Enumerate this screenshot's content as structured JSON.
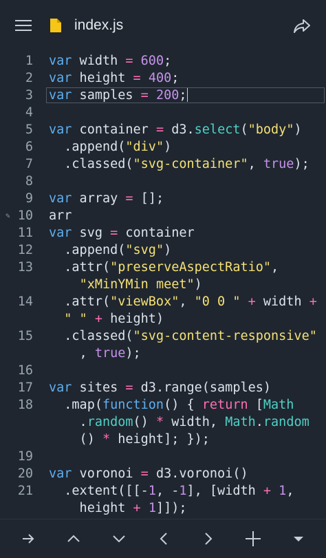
{
  "header": {
    "file_name": "index.js",
    "menu_icon": "hamburger-icon",
    "file_icon": "js-file-icon",
    "share_icon": "share-icon"
  },
  "colors": {
    "background": "#1f2630",
    "keyword": "#5fb0f0",
    "operator": "#ff6fb5",
    "number": "#c792ea",
    "string": "#f5e173",
    "function": "#4fd1c5",
    "text": "#dde3ea",
    "line_number": "#9aa4af"
  },
  "editor": {
    "current_line": 3,
    "lines": [
      {
        "num": "1",
        "tokens": [
          [
            "k",
            "var"
          ],
          [
            "p",
            " width "
          ],
          [
            "o",
            "="
          ],
          [
            "p",
            " "
          ],
          [
            "n",
            "600"
          ],
          [
            "p",
            ";"
          ]
        ]
      },
      {
        "num": "2",
        "tokens": [
          [
            "k",
            "var"
          ],
          [
            "p",
            " height "
          ],
          [
            "o",
            "="
          ],
          [
            "p",
            " "
          ],
          [
            "n",
            "400"
          ],
          [
            "p",
            ";"
          ]
        ]
      },
      {
        "num": "3",
        "tokens": [
          [
            "k",
            "var"
          ],
          [
            "p",
            " samples "
          ],
          [
            "o",
            "="
          ],
          [
            "p",
            " "
          ],
          [
            "n",
            "200"
          ],
          [
            "p",
            ";"
          ]
        ]
      },
      {
        "num": "4",
        "tokens": []
      },
      {
        "num": "5",
        "tokens": [
          [
            "k",
            "var"
          ],
          [
            "p",
            " container "
          ],
          [
            "o",
            "="
          ],
          [
            "p",
            " d3."
          ],
          [
            "f",
            "select"
          ],
          [
            "p",
            "("
          ],
          [
            "s",
            "\"body\""
          ],
          [
            "p",
            ")"
          ]
        ]
      },
      {
        "num": "6",
        "tokens": [
          [
            "p",
            "  ."
          ],
          [
            "p",
            "append("
          ],
          [
            "s",
            "\"div\""
          ],
          [
            "p",
            ")"
          ]
        ]
      },
      {
        "num": "7",
        "tokens": [
          [
            "p",
            "  .classed("
          ],
          [
            "s",
            "\"svg-container\""
          ],
          [
            "p",
            ", "
          ],
          [
            "n",
            "true"
          ],
          [
            "p",
            ");"
          ]
        ]
      },
      {
        "num": "8",
        "tokens": []
      },
      {
        "num": "9",
        "tokens": [
          [
            "k",
            "var"
          ],
          [
            "p",
            " array "
          ],
          [
            "o",
            "="
          ],
          [
            "p",
            " [];"
          ]
        ]
      },
      {
        "num": "10",
        "tokens": [
          [
            "p",
            "arr"
          ]
        ]
      },
      {
        "num": "11",
        "tokens": [
          [
            "k",
            "var"
          ],
          [
            "p",
            " svg "
          ],
          [
            "o",
            "="
          ],
          [
            "p",
            " container"
          ]
        ]
      },
      {
        "num": "12",
        "tokens": [
          [
            "p",
            "  .append("
          ],
          [
            "s",
            "\"svg\""
          ],
          [
            "p",
            ")"
          ]
        ]
      },
      {
        "num": "13",
        "tokens": [
          [
            "p",
            "  .attr("
          ],
          [
            "s",
            "\"preserveAspectRatio\""
          ],
          [
            "p",
            ","
          ]
        ]
      },
      {
        "num": "",
        "tokens": [
          [
            "p",
            "    "
          ],
          [
            "s",
            "\"xMinYMin meet\""
          ],
          [
            "p",
            ")"
          ]
        ]
      },
      {
        "num": "14",
        "tokens": [
          [
            "p",
            "  .attr("
          ],
          [
            "s",
            "\"viewBox\""
          ],
          [
            "p",
            ", "
          ],
          [
            "s",
            "\"0 0 \""
          ],
          [
            "p",
            " "
          ],
          [
            "o",
            "+"
          ],
          [
            "p",
            " width "
          ],
          [
            "o",
            "+"
          ]
        ]
      },
      {
        "num": "",
        "tokens": [
          [
            "p",
            "  "
          ],
          [
            "s",
            "\" \""
          ],
          [
            "p",
            " "
          ],
          [
            "o",
            "+"
          ],
          [
            "p",
            " height)"
          ]
        ]
      },
      {
        "num": "15",
        "tokens": [
          [
            "p",
            "  .classed("
          ],
          [
            "s",
            "\"svg-content-responsive\""
          ]
        ]
      },
      {
        "num": "",
        "tokens": [
          [
            "p",
            "    , "
          ],
          [
            "n",
            "true"
          ],
          [
            "p",
            ");"
          ]
        ]
      },
      {
        "num": "16",
        "tokens": []
      },
      {
        "num": "17",
        "tokens": [
          [
            "k",
            "var"
          ],
          [
            "p",
            " sites "
          ],
          [
            "o",
            "="
          ],
          [
            "p",
            " d3.range(samples)"
          ]
        ]
      },
      {
        "num": "18",
        "tokens": [
          [
            "p",
            "  .map("
          ],
          [
            "k",
            "function"
          ],
          [
            "p",
            "() { "
          ],
          [
            "o",
            "return"
          ],
          [
            "p",
            " ["
          ],
          [
            "f",
            "Math"
          ]
        ]
      },
      {
        "num": "",
        "tokens": [
          [
            "p",
            "    ."
          ],
          [
            "f",
            "random"
          ],
          [
            "p",
            "() "
          ],
          [
            "o",
            "*"
          ],
          [
            "p",
            " width, "
          ],
          [
            "f",
            "Math"
          ],
          [
            "p",
            "."
          ],
          [
            "f",
            "random"
          ]
        ]
      },
      {
        "num": "",
        "tokens": [
          [
            "p",
            "    () "
          ],
          [
            "o",
            "*"
          ],
          [
            "p",
            " height]; });"
          ]
        ]
      },
      {
        "num": "19",
        "tokens": []
      },
      {
        "num": "20",
        "tokens": [
          [
            "k",
            "var"
          ],
          [
            "p",
            " voronoi "
          ],
          [
            "o",
            "="
          ],
          [
            "p",
            " d3.voronoi()"
          ]
        ]
      },
      {
        "num": "21",
        "tokens": [
          [
            "p",
            "  .extent([[-"
          ],
          [
            "n",
            "1"
          ],
          [
            "p",
            ", -"
          ],
          [
            "n",
            "1"
          ],
          [
            "p",
            "], [width "
          ],
          [
            "o",
            "+"
          ],
          [
            "p",
            " "
          ],
          [
            "n",
            "1"
          ],
          [
            "p",
            ","
          ]
        ]
      },
      {
        "num": "",
        "tokens": [
          [
            "p",
            "    height "
          ],
          [
            "o",
            "+"
          ],
          [
            "p",
            " "
          ],
          [
            "n",
            "1"
          ],
          [
            "p",
            "]]);"
          ]
        ]
      }
    ]
  },
  "bottom_toolbar": {
    "buttons": [
      "arrow-right-icon",
      "chevron-up-icon",
      "chevron-down-icon",
      "chevron-left-icon",
      "chevron-right-icon",
      "plus-icon",
      "caret-down-icon"
    ]
  }
}
